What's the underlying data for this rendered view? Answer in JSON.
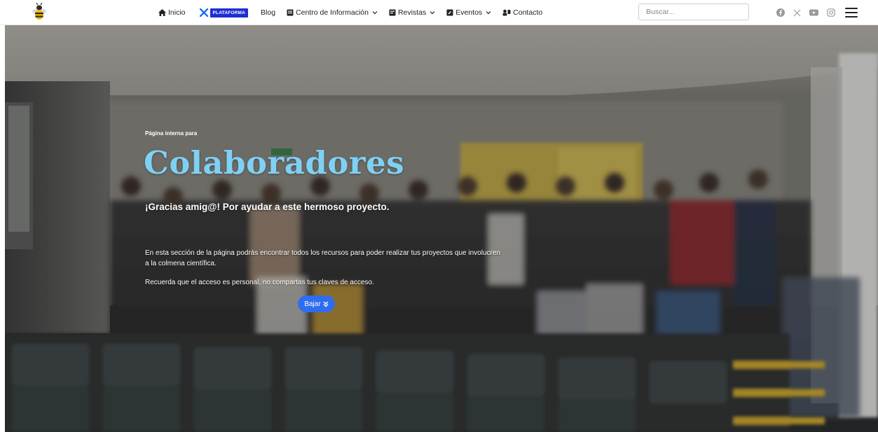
{
  "nav": {
    "items": [
      {
        "label": "Inicio",
        "icon": "home-icon"
      },
      {
        "label": "PLATAFORMA",
        "icon": "tools-icon",
        "badge": true
      },
      {
        "label": "Blog"
      },
      {
        "label": "Centro de Información",
        "icon": "book-icon",
        "dropdown": true
      },
      {
        "label": "Revistas",
        "icon": "journal-icon",
        "dropdown": true
      },
      {
        "label": "Eventos",
        "icon": "calendar-edit-icon",
        "dropdown": true
      },
      {
        "label": "Contacto",
        "icon": "contact-icon"
      }
    ],
    "search_placeholder": "Buscar...",
    "socials": [
      "facebook-icon",
      "x-icon",
      "youtube-icon",
      "instagram-icon"
    ]
  },
  "colors": {
    "accent_blue": "#2f6df0",
    "title_blue": "#7fd0f5",
    "badge_blue": "#1d2fd1"
  },
  "hero": {
    "eyebrow": "Página interna para",
    "title": "Colaboradores",
    "subtitle": "¡Gracias amig@! Por ayudar a este hermoso proyecto.",
    "description": "En esta sección de la página podrás encontrar todos los recursos para poder realizar tus proyectos que involucren a la colmena científica.",
    "note": "Recuerda que el acceso es personal, no compartas tus claves de acceso.",
    "button_label": "Bajar"
  }
}
